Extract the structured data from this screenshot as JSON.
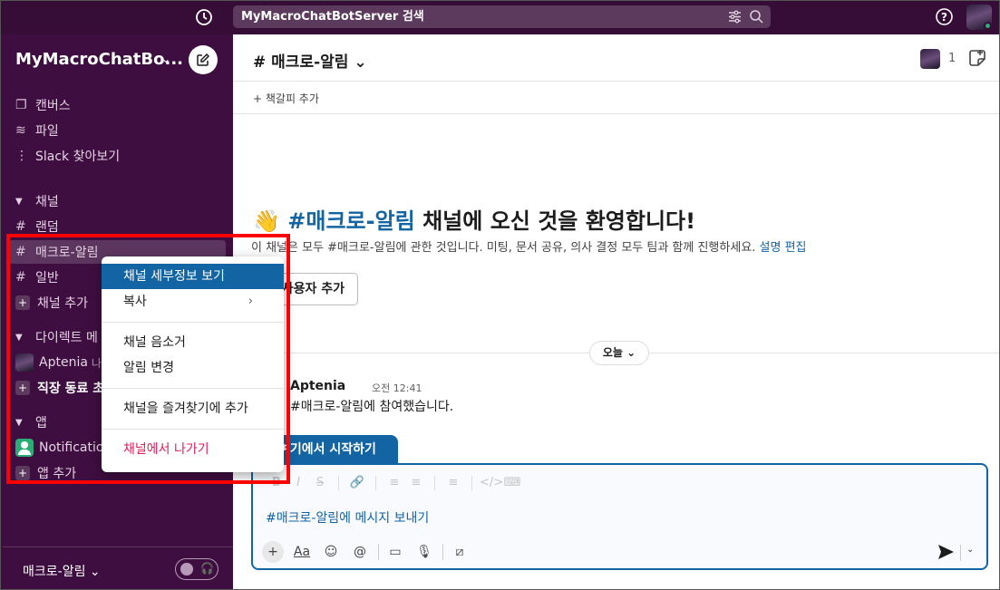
{
  "search": {
    "label": "MyMacroChatBotServer 검색"
  },
  "workspace": {
    "name": "MyMacroChatBo...",
    "chevron": "⌄"
  },
  "nav": [
    {
      "label": "캔버스",
      "icon": "canvas-icon",
      "glyph": "❐"
    },
    {
      "label": "파일",
      "icon": "layers-icon",
      "glyph": "≋"
    },
    {
      "label": "Slack 찾아보기",
      "icon": "more-icon",
      "glyph": "⋮"
    }
  ],
  "channels_section": {
    "title": "채널"
  },
  "channels": [
    {
      "label": "랜덤"
    },
    {
      "label": "매크로-알림"
    },
    {
      "label": "일반"
    }
  ],
  "add_channel": {
    "label": "채널 추가"
  },
  "dm_section": {
    "title": "다이렉트 메"
  },
  "dms": [
    {
      "label": "Aptenia",
      "suffix": "나"
    },
    {
      "label": "직장 동료 초"
    }
  ],
  "apps_section": {
    "title": "앱"
  },
  "apps": [
    {
      "label": "Notification"
    }
  ],
  "add_app": {
    "label": "앱 추가"
  },
  "footer": {
    "label": "매크로-알림 ⌄"
  },
  "header": {
    "title": "# 매크로-알림 ⌄",
    "member_count": "1"
  },
  "bookmark": {
    "label": "+  책갈피 추가"
  },
  "welcome": {
    "emoji": "👋",
    "prefix": "#",
    "channel": "매크로-알림",
    "suffix": "채널에 오신 것을 환영합니다!",
    "description": "이 채널은 모두 #매크로-알림에 관한 것입니다. 미팅, 문서 공유, 의사 결정 모두 팀과 함께 진행하세요.",
    "edit_link": "설명 편집",
    "add_user_button": "사용자 추가"
  },
  "date_pill": {
    "label": "오늘 ⌄"
  },
  "message": {
    "author": "Aptenia",
    "time": "오전 12:41",
    "text": "#매크로-알림에 참여했습니다."
  },
  "composer": {
    "start_tab": "여기에서 시작하기",
    "placeholder": "#매크로-알림에 메시지 보내기",
    "format_buttons": [
      "B",
      "I",
      "S",
      "🔗",
      "≡",
      "≡",
      "≡",
      "</>",
      "⌨"
    ]
  },
  "context_menu": {
    "items": [
      {
        "label": "채널 세부정보 보기",
        "active": true
      },
      {
        "label": "복사",
        "arrow": "›"
      },
      {
        "label": "채널 음소거"
      },
      {
        "label": "알림 변경"
      },
      {
        "label": "채널을 즐겨찾기에 추가"
      },
      {
        "label": "채널에서 나가기",
        "danger": true
      }
    ]
  },
  "colors": {
    "sidebar_bg": "#3f0e40",
    "topbar_bg": "#350d36",
    "accent": "#1264a3",
    "danger": "#e01e5a",
    "highlight": "#ff0000"
  }
}
